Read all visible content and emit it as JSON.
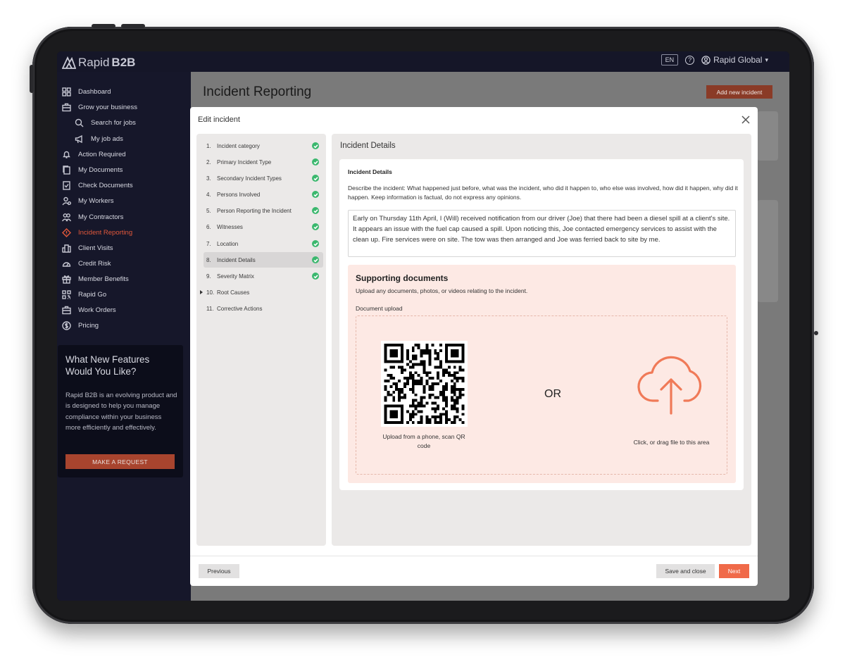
{
  "app": {
    "logo_text_light": "Rapid",
    "logo_text_bold": "B2B"
  },
  "topbar": {
    "language": "EN",
    "help_icon": "help-icon",
    "account_name": "Rapid Global",
    "account_caret": "▾"
  },
  "sidebar": {
    "items": [
      {
        "label": "Dashboard",
        "icon": "dashboard-icon"
      },
      {
        "label": "Grow your business",
        "icon": "briefcase-icon"
      },
      {
        "label": "Search for jobs",
        "icon": "search-icon"
      },
      {
        "label": "My job ads",
        "icon": "megaphone-icon"
      },
      {
        "label": "Action Required",
        "icon": "bell-icon"
      },
      {
        "label": "My Documents",
        "icon": "documents-icon"
      },
      {
        "label": "Check Documents",
        "icon": "check-document-icon"
      },
      {
        "label": "My Workers",
        "icon": "workers-icon"
      },
      {
        "label": "My Contractors",
        "icon": "contractors-icon"
      },
      {
        "label": "Incident Reporting",
        "icon": "warning-icon",
        "active": true
      },
      {
        "label": "Client Visits",
        "icon": "building-icon"
      },
      {
        "label": "Credit Risk",
        "icon": "gauge-icon"
      },
      {
        "label": "Member Benefits",
        "icon": "gift-icon"
      },
      {
        "label": "Rapid Go",
        "icon": "qr-code-icon"
      },
      {
        "label": "Work Orders",
        "icon": "work-orders-icon"
      },
      {
        "label": "Pricing",
        "icon": "dollar-icon"
      }
    ],
    "promo": {
      "title": "What New Features Would You Like?",
      "body": "Rapid B2B is an evolving product and is designed to help you manage compliance within your business more efficiently and effectively.",
      "button": "MAKE A REQUEST"
    }
  },
  "page": {
    "title": "Incident Reporting",
    "add_button": "Add new incident"
  },
  "modal": {
    "title": "Edit incident",
    "steps": [
      {
        "num": "1.",
        "label": "Incident category",
        "done": true
      },
      {
        "num": "2.",
        "label": "Primary Incident Type",
        "done": true
      },
      {
        "num": "3.",
        "label": "Secondary Incident Types",
        "done": true
      },
      {
        "num": "4.",
        "label": "Persons Involved",
        "done": true
      },
      {
        "num": "5.",
        "label": "Person Reporting the Incident",
        "done": true
      },
      {
        "num": "6.",
        "label": "Witnesses",
        "done": true
      },
      {
        "num": "7.",
        "label": "Location",
        "done": true
      },
      {
        "num": "8.",
        "label": "Incident Details",
        "done": true,
        "current": true
      },
      {
        "num": "9.",
        "label": "Severity Matrix",
        "done": true
      },
      {
        "num": "10.",
        "label": "Root Causes",
        "done": false
      },
      {
        "num": "11.",
        "label": "Corrective Actions",
        "done": false
      }
    ],
    "section_title": "Incident Details",
    "card": {
      "title": "Incident Details",
      "description": "Describe the incident: What happened just before, what was the incident, who did it happen to, who else was involved, how did it happen, why did it happen. Keep information is factual, do not express any opinions.",
      "text_value": "Early on Thursday 11th April, I (Will) received notification from our driver (Joe) that there had been a diesel spill at a client's site. It appears an issue with the fuel cap caused a spill. Upon noticing this, Joe contacted emergency services to assist with the clean up. Fire services were on site. The tow was then arranged and Joe was ferried back to site by me."
    },
    "supporting": {
      "title": "Supporting documents",
      "subtitle": "Upload any documents, photos, or videos relating to the incident.",
      "upload_label": "Document upload",
      "qr_caption": "Upload from a phone, scan QR code",
      "or_text": "OR",
      "drop_caption": "Click, or drag file to this area"
    },
    "buttons": {
      "previous": "Previous",
      "save_close": "Save and close",
      "next": "Next"
    }
  },
  "colors": {
    "accent": "#f06a49",
    "sidebar_bg": "#16172a",
    "success": "#3bb86e",
    "active_nav": "#e2583b",
    "upload_bg": "#fde9e4"
  }
}
